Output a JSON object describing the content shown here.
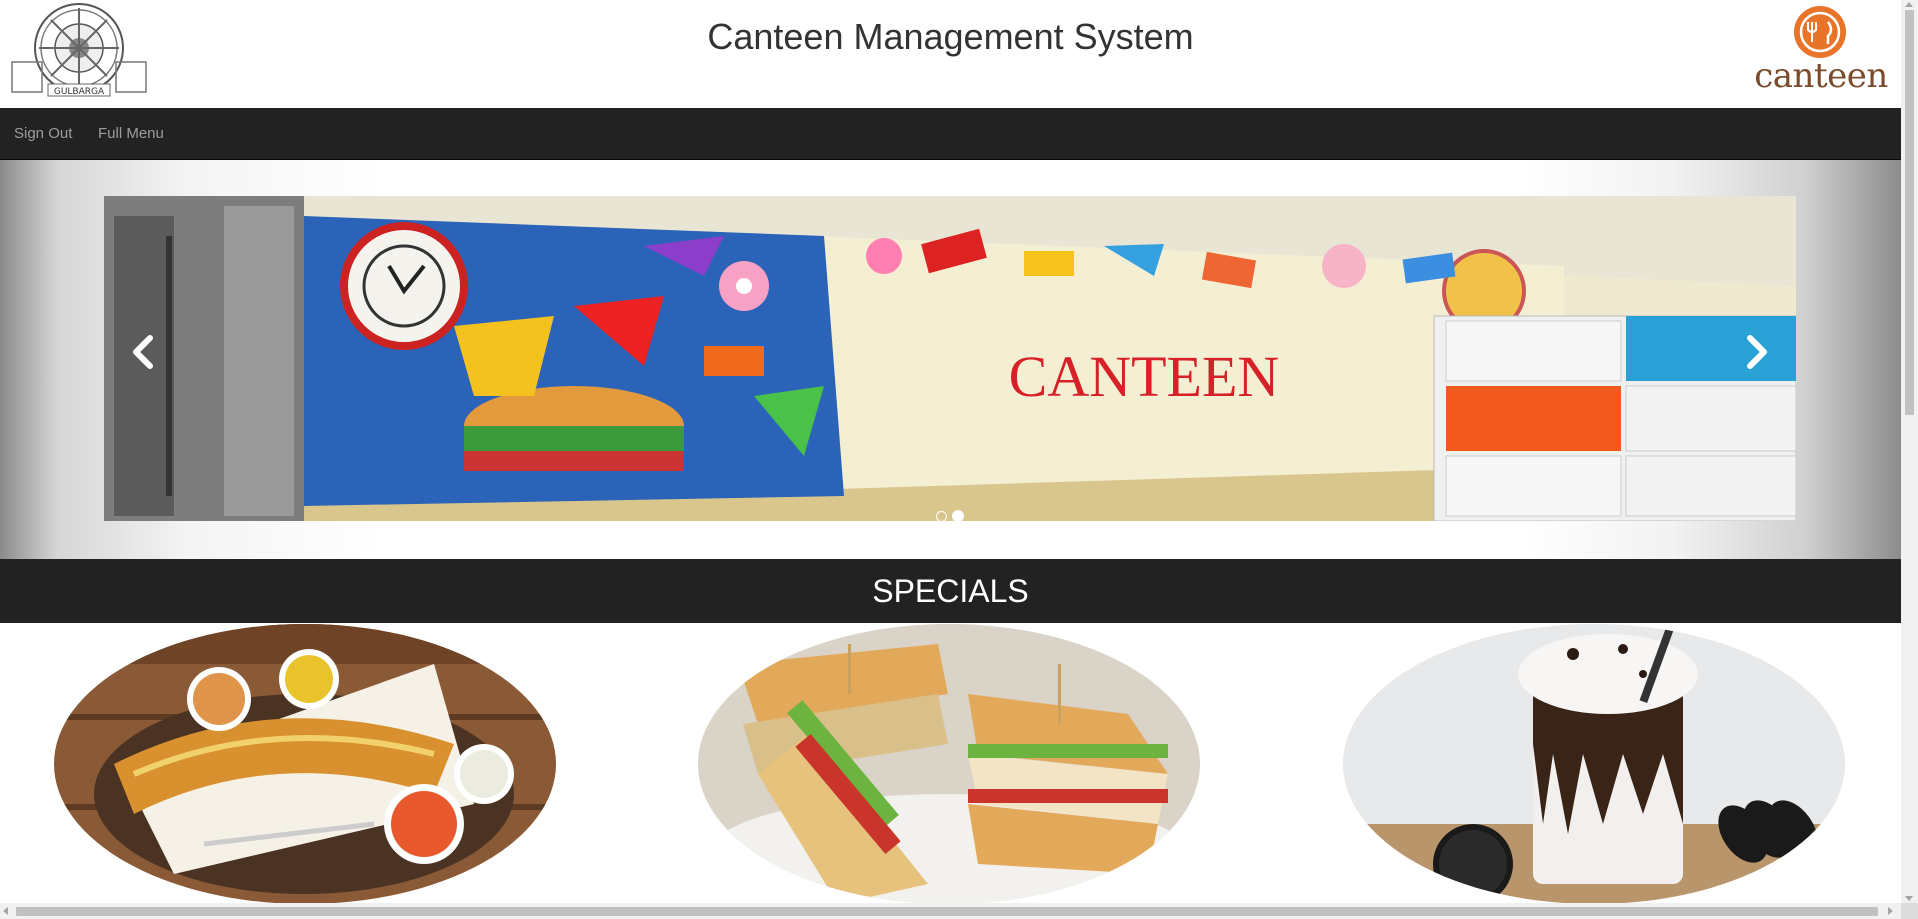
{
  "header": {
    "title": "Canteen Management System",
    "college_logo_text": "GULBARGA",
    "brand_logo_text": "canteen",
    "brand_color": "#e8742a"
  },
  "navbar": {
    "items": [
      {
        "label": "Sign Out"
      },
      {
        "label": "Full Menu"
      }
    ],
    "background": "#222222",
    "link_color": "#9d9d9d"
  },
  "carousel": {
    "slide_text": "CANTEEN",
    "slide_count": 2,
    "active_slide": 2,
    "prev_icon": "chevron-left-icon",
    "next_icon": "chevron-right-icon"
  },
  "specials": {
    "title": "SPECIALS",
    "items": [
      {
        "icon": "dosa-image"
      },
      {
        "icon": "sandwich-image"
      },
      {
        "icon": "milkshake-image"
      }
    ]
  }
}
